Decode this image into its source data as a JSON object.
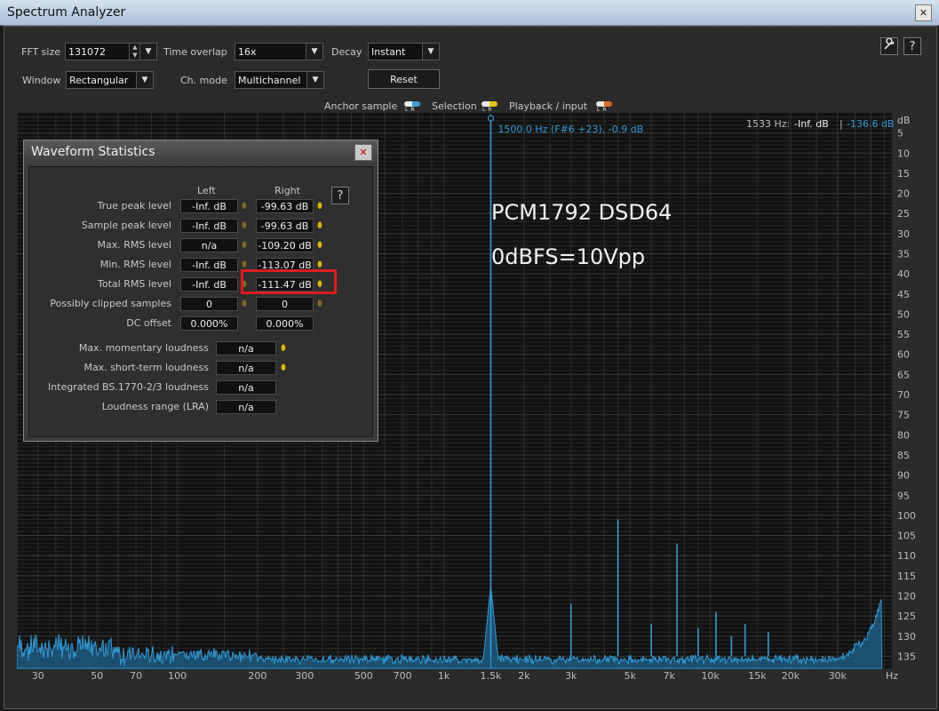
{
  "window": {
    "title": "Spectrum Analyzer",
    "close_glyph": "✕"
  },
  "controls": {
    "fft_size_label": "FFT size",
    "fft_size_value": "131072",
    "time_overlap_label": "Time overlap",
    "time_overlap_value": "16x",
    "decay_label": "Decay",
    "decay_value": "Instant",
    "window_label": "Window",
    "window_value": "Rectangular",
    "ch_mode_label": "Ch. mode",
    "ch_mode_value": "Multichannel",
    "reset_label": "Reset",
    "settings_icon": "wrench-icon",
    "help_glyph": "?"
  },
  "legend": {
    "anchor_label": "Anchor sample",
    "selection_label": "Selection",
    "playback_label": "Playback / input",
    "lr_text": "LR",
    "anchor_colors": [
      "#e8e8e8",
      "#3aa0e0"
    ],
    "selection_colors": [
      "#e8e8e8",
      "#e8c800"
    ],
    "playback_colors": [
      "#e8e8e8",
      "#e07020"
    ]
  },
  "overlay": {
    "line1": "PCM1792  DSD64",
    "line2": "0dBFS=10Vpp"
  },
  "dialog": {
    "title": "Waveform Statistics",
    "close_glyph": "✕",
    "help_glyph": "?",
    "col_left": "Left",
    "col_right": "Right",
    "rows": [
      {
        "label": "True peak level",
        "left": "-Inf. dB",
        "right": "-99.63 dB"
      },
      {
        "label": "Sample peak level",
        "left": "-Inf. dB",
        "right": "-99.63 dB"
      },
      {
        "label": "Max. RMS level",
        "left": "n/a",
        "right": "-109.20 dB"
      },
      {
        "label": "Min. RMS level",
        "left": "-Inf. dB",
        "right": "-113.07 dB"
      },
      {
        "label": "Total RMS level",
        "left": "-Inf. dB",
        "right": "-111.47 dB"
      },
      {
        "label": "Possibly clipped samples",
        "left": "0",
        "right": "0"
      },
      {
        "label": "DC offset",
        "left": "0.000%",
        "right": "0.000%"
      }
    ],
    "loudness": [
      {
        "label": "Max. momentary loudness",
        "value": "n/a"
      },
      {
        "label": "Max. short-term loudness",
        "value": "n/a"
      },
      {
        "label": "Integrated BS.1770-2/3 loudness",
        "value": "n/a"
      },
      {
        "label": "Loudness range (LRA)",
        "value": "n/a"
      }
    ]
  },
  "chart_data": {
    "type": "area",
    "x_scale": "log",
    "xlim": [
      25,
      48000
    ],
    "ylim": [
      -138,
      0
    ],
    "y_unit": "dB",
    "x_unit": "Hz",
    "x_ticks": [
      30,
      50,
      70,
      100,
      200,
      300,
      500,
      700,
      1000,
      1500,
      2000,
      3000,
      5000,
      7000,
      10000,
      15000,
      20000,
      30000
    ],
    "x_tick_labels": [
      "30",
      "50",
      "70",
      "100",
      "200",
      "300",
      "500",
      "700",
      "1k",
      "1.5k",
      "2k",
      "3k",
      "5k",
      "7k",
      "10k",
      "15k",
      "20k",
      "30k"
    ],
    "y_ticks": [
      5,
      10,
      15,
      20,
      25,
      30,
      35,
      40,
      45,
      50,
      55,
      60,
      65,
      70,
      75,
      80,
      85,
      90,
      95,
      100,
      105,
      110,
      115,
      120,
      125,
      130,
      135
    ],
    "cursor_readout": {
      "freq": "1533 Hz:",
      "left_val": "-Inf. dB",
      "sep": "|",
      "right_val": "-136.6 dB",
      "unit_top": "dB"
    },
    "marker": {
      "freq": 1500,
      "label": "1500.0 Hz (F#6 +23), -0.9 dB",
      "level": -0.9
    },
    "noise_floor": -135,
    "peaks": [
      {
        "freq": 1500,
        "level": -0.9
      },
      {
        "freq": 3000,
        "level": -122
      },
      {
        "freq": 4500,
        "level": -101
      },
      {
        "freq": 6000,
        "level": -127
      },
      {
        "freq": 7500,
        "level": -107
      },
      {
        "freq": 9000,
        "level": -128
      },
      {
        "freq": 10500,
        "level": -124
      },
      {
        "freq": 12000,
        "level": -130
      },
      {
        "freq": 13500,
        "level": -127
      },
      {
        "freq": 16500,
        "level": -129
      }
    ],
    "hf_noise_hump": [
      {
        "freq": 30000,
        "level": -136
      },
      {
        "freq": 38000,
        "level": -131
      },
      {
        "freq": 42000,
        "level": -125
      },
      {
        "freq": 44000,
        "level": -121
      },
      {
        "freq": 45500,
        "level": -122
      },
      {
        "freq": 46500,
        "level": -126
      },
      {
        "freq": 47000,
        "level": -137
      }
    ],
    "colors": {
      "trace": "#2f9bd8",
      "fill": "#1d5a80",
      "grid": "#3a3a3a",
      "marker": "#2f9bd8"
    }
  }
}
